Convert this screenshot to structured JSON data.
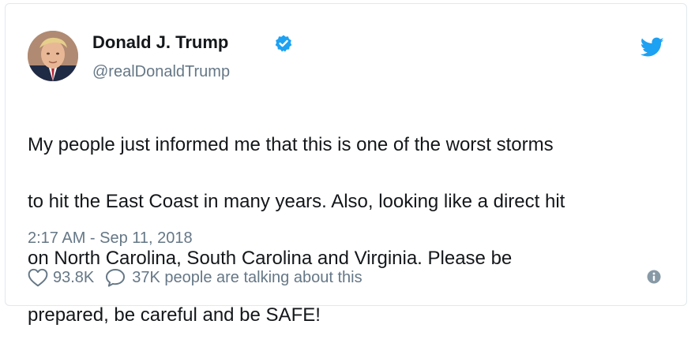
{
  "author": {
    "name": "Donald J. Trump",
    "handle": "@realDonaldTrump",
    "verified": true,
    "avatar_icon": "avatar-portrait"
  },
  "tweet": {
    "lines": [
      "My people just informed me that this is one of the worst storms",
      "to hit the East Coast in many years. Also, looking like a direct hit",
      "on North Carolina, South Carolina and Virginia. Please be",
      "prepared, be careful and be SAFE!"
    ],
    "timestamp": "2:17 AM - Sep 11, 2018"
  },
  "actions": {
    "like_count": "93.8K",
    "talking_text": "37K people are talking about this"
  },
  "icons": {
    "brand": "twitter-bird-icon",
    "verified": "verified-badge-icon",
    "like": "heart-icon",
    "reply": "speech-bubble-icon",
    "info": "info-icon"
  },
  "colors": {
    "brand_blue": "#1da1f2",
    "text_primary": "#14171a",
    "text_secondary": "#657786",
    "border": "#e1e8ed"
  }
}
